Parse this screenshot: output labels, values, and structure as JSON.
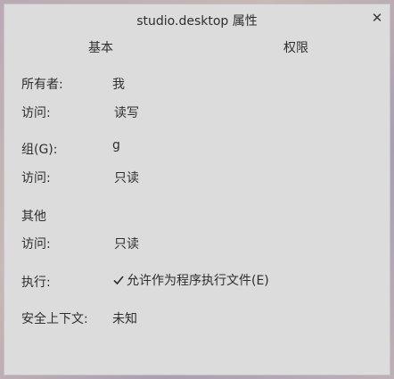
{
  "window": {
    "title": "studio.desktop 属性",
    "close_icon": "close-icon"
  },
  "tabs": [
    {
      "label": "基本"
    },
    {
      "label": "权限"
    }
  ],
  "owner": {
    "label": "所有者:",
    "value": "我",
    "access_label": "访问:",
    "access_value": "读写"
  },
  "group": {
    "label": "组(G):",
    "value": "g",
    "access_label": "访问:",
    "access_value": "只读"
  },
  "others": {
    "label": "其他",
    "access_label": "访问:",
    "access_value": "只读"
  },
  "execute": {
    "label": "执行:",
    "checkbox_label": "允许作为程序执行文件(E)",
    "checked": true
  },
  "security_context": {
    "label": "安全上下文:",
    "value": "未知"
  }
}
